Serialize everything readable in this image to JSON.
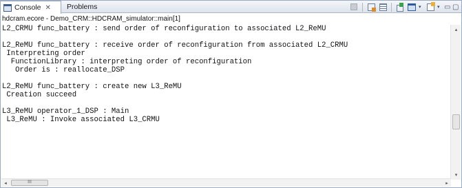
{
  "tabs": [
    {
      "label": "Console",
      "close_glyph": "✕",
      "icon": "console-icon",
      "active": true
    },
    {
      "label": "Problems",
      "active": false
    }
  ],
  "toolbar": {
    "icons": [
      "terminate-icon",
      "clear-console-icon",
      "scroll-lock-icon",
      "pin-console-icon",
      "display-console-icon",
      "open-console-icon"
    ],
    "dropdown_glyph": "▾",
    "minimize_glyph": "▭",
    "maximize_glyph": "▢"
  },
  "process_label": "hdcram.ecore - Demo_CRM::HDCRAM_simulator::main[1]",
  "console_lines": [
    "L2_CRMU func_battery : send order of reconfiguration to associated L2_ReMU",
    "",
    "L2_ReMU func_battery : receive order of reconfiguration from associated L2_CRMU",
    " Interpreting order",
    "  FunctionLibrary : interpreting order of reconfiguration",
    "   Order is : reallocate_DSP",
    "",
    "L2_ReMU func_battery : create new L3_ReMU",
    " Creation succeed",
    "",
    "L3_ReMU operator_1_DSP : Main",
    " L3_ReMU : Invoke associated L3_CRMU"
  ],
  "scrollbar": {
    "up_glyph": "▴",
    "down_glyph": "▾",
    "left_glyph": "◂",
    "right_glyph": "▸",
    "thumb_grip": "III"
  },
  "colors": {
    "tab_border": "#9aaac0",
    "text": "#111111",
    "accent": "#3a5b8c"
  }
}
